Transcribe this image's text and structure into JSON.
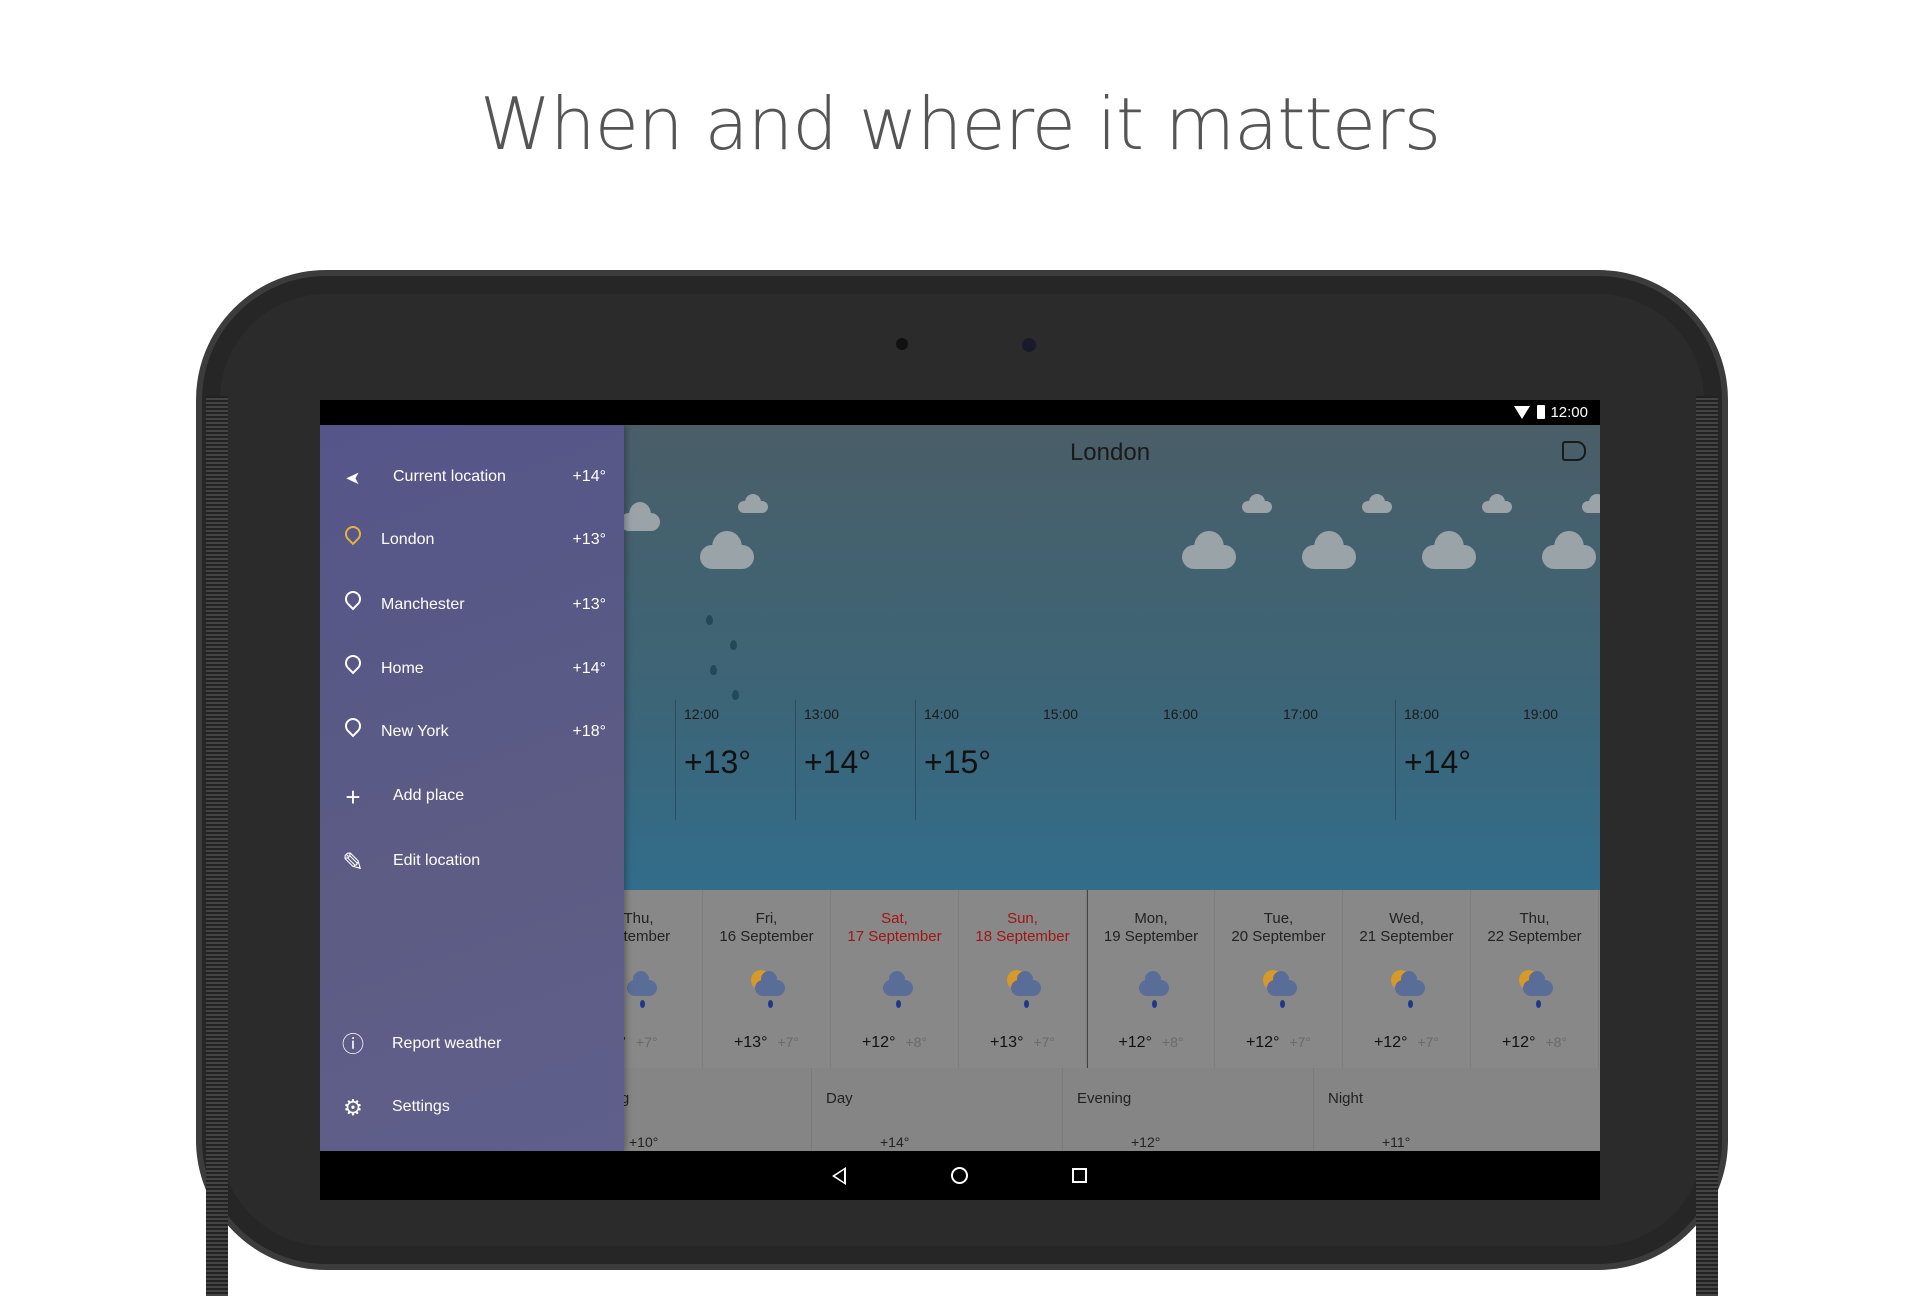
{
  "headline": "When and where it matters",
  "status": {
    "time": "12:00"
  },
  "city": "London",
  "drawer": {
    "items": [
      {
        "icon": "navigation-arrow-icon",
        "label": "Current location",
        "temp": "+14°"
      },
      {
        "icon": "location-pin-icon",
        "label": "London",
        "temp": "+13°",
        "active": true
      },
      {
        "icon": "location-pin-icon",
        "label": "Manchester",
        "temp": "+13°"
      },
      {
        "icon": "location-pin-icon",
        "label": "Home",
        "temp": "+14°"
      },
      {
        "icon": "location-pin-icon",
        "label": "New York",
        "temp": "+18°"
      },
      {
        "icon": "plus-icon",
        "label": "Add place"
      },
      {
        "icon": "pencil-icon",
        "label": "Edit location"
      }
    ],
    "bottom": [
      {
        "icon": "info-icon",
        "label": "Report weather"
      },
      {
        "icon": "gear-icon",
        "label": "Settings"
      }
    ]
  },
  "hourly": [
    {
      "time": "12:00",
      "temp": "+13°"
    },
    {
      "time": "13:00",
      "temp": "+14°"
    },
    {
      "time": "14:00",
      "temp": "+15°"
    },
    {
      "time": "15:00",
      "temp": ""
    },
    {
      "time": "16:00",
      "temp": ""
    },
    {
      "time": "17:00",
      "temp": ""
    },
    {
      "time": "18:00",
      "temp": "+14°"
    },
    {
      "time": "19:00",
      "temp": ""
    }
  ],
  "days": [
    {
      "dow": "Thu,",
      "date": "eptember",
      "hi": "°",
      "lo": "+7°",
      "icon": "rain-icon"
    },
    {
      "dow": "Fri,",
      "date": "16 September",
      "hi": "+13°",
      "lo": "+7°",
      "icon": "sun-cloud-rain-icon"
    },
    {
      "dow": "Sat,",
      "date": "17 September",
      "hi": "+12°",
      "lo": "+8°",
      "icon": "rain-icon",
      "weekend": true
    },
    {
      "dow": "Sun,",
      "date": "18 September",
      "hi": "+13°",
      "lo": "+7°",
      "icon": "sun-cloud-rain-icon",
      "weekend": true
    },
    {
      "dow": "Mon,",
      "date": "19 September",
      "hi": "+12°",
      "lo": "+8°",
      "icon": "rain-icon"
    },
    {
      "dow": "Tue,",
      "date": "20 September",
      "hi": "+12°",
      "lo": "+7°",
      "icon": "sun-cloud-rain-icon"
    },
    {
      "dow": "Wed,",
      "date": "21 September",
      "hi": "+12°",
      "lo": "+7°",
      "icon": "sun-cloud-rain-icon"
    },
    {
      "dow": "Thu,",
      "date": "22 September",
      "hi": "+12°",
      "lo": "+8°",
      "icon": "sun-cloud-rain-icon"
    }
  ],
  "parts": [
    {
      "label": "Morning",
      "temp": "+10°"
    },
    {
      "label": "Day",
      "temp": "+14°"
    },
    {
      "label": "Evening",
      "temp": "+12°"
    },
    {
      "label": "Night",
      "temp": "+11°"
    }
  ],
  "colors": {
    "weekend": "#a01515",
    "active_pin": "#e6b33a"
  }
}
